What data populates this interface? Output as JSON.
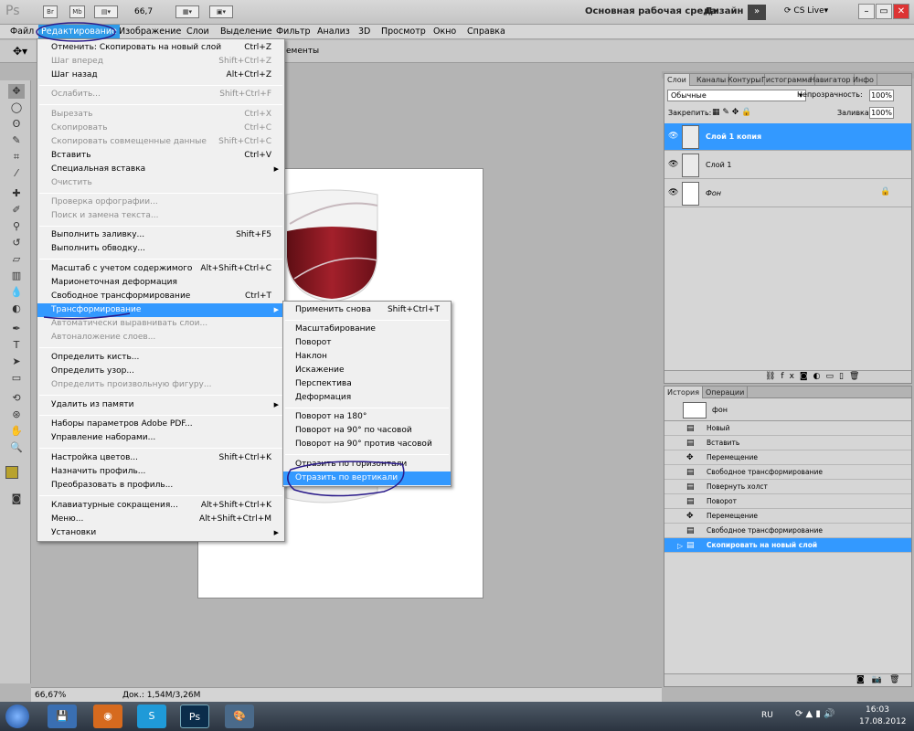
{
  "appbar": {
    "logo": "Ps",
    "br_label": "Br",
    "mb_label": "Mb",
    "zoom": "66,7",
    "workspace": "Основная рабочая среда",
    "design": "Дизайн",
    "cslive": "CS Live"
  },
  "menubar": {
    "items": [
      "Файл",
      "Редактирование",
      "Изображение",
      "Слои",
      "Выделение",
      "Фильтр",
      "Анализ",
      "3D",
      "Просмотр",
      "Окно",
      "Справка"
    ]
  },
  "options": {
    "text": "ементы"
  },
  "edit_menu": {
    "items": [
      {
        "label": "Отменить: Скопировать на новый слой",
        "shortcut": "Ctrl+Z"
      },
      {
        "label": "Шаг вперед",
        "shortcut": "Shift+Ctrl+Z"
      },
      {
        "label": "Шаг назад",
        "shortcut": "Alt+Ctrl+Z"
      },
      {
        "label": "Ослабить...",
        "shortcut": "Shift+Ctrl+F"
      },
      {
        "label": "Вырезать",
        "shortcut": "Ctrl+X"
      },
      {
        "label": "Скопировать",
        "shortcut": "Ctrl+C"
      },
      {
        "label": "Скопировать совмещенные данные",
        "shortcut": "Shift+Ctrl+C"
      },
      {
        "label": "Вставить",
        "shortcut": "Ctrl+V"
      },
      {
        "label": "Специальная вставка",
        "shortcut": ""
      },
      {
        "label": "Очистить",
        "shortcut": ""
      },
      {
        "label": "Проверка орфографии...",
        "shortcut": ""
      },
      {
        "label": "Поиск и замена текста...",
        "shortcut": ""
      },
      {
        "label": "Выполнить заливку...",
        "shortcut": "Shift+F5"
      },
      {
        "label": "Выполнить обводку...",
        "shortcut": ""
      },
      {
        "label": "Масштаб с учетом содержимого",
        "shortcut": "Alt+Shift+Ctrl+C"
      },
      {
        "label": "Марионеточная деформация",
        "shortcut": ""
      },
      {
        "label": "Свободное трансформирование",
        "shortcut": "Ctrl+T"
      },
      {
        "label": "Трансформирование",
        "shortcut": ""
      },
      {
        "label": "Автоматически выравнивать слои...",
        "shortcut": ""
      },
      {
        "label": "Автоналожение слоев...",
        "shortcut": ""
      },
      {
        "label": "Определить кисть...",
        "shortcut": ""
      },
      {
        "label": "Определить узор...",
        "shortcut": ""
      },
      {
        "label": "Определить произвольную фигуру...",
        "shortcut": ""
      },
      {
        "label": "Удалить из памяти",
        "shortcut": ""
      },
      {
        "label": "Наборы параметров Adobe PDF...",
        "shortcut": ""
      },
      {
        "label": "Управление наборами...",
        "shortcut": ""
      },
      {
        "label": "Настройка цветов...",
        "shortcut": "Shift+Ctrl+K"
      },
      {
        "label": "Назначить профиль...",
        "shortcut": ""
      },
      {
        "label": "Преобразовать в профиль...",
        "shortcut": ""
      },
      {
        "label": "Клавиатурные сокращения...",
        "shortcut": "Alt+Shift+Ctrl+K"
      },
      {
        "label": "Меню...",
        "shortcut": "Alt+Shift+Ctrl+M"
      },
      {
        "label": "Установки",
        "shortcut": ""
      }
    ]
  },
  "transform_menu": {
    "items": [
      {
        "label": "Применить снова",
        "shortcut": "Shift+Ctrl+T"
      },
      {
        "label": "Масштабирование",
        "shortcut": ""
      },
      {
        "label": "Поворот",
        "shortcut": ""
      },
      {
        "label": "Наклон",
        "shortcut": ""
      },
      {
        "label": "Искажение",
        "shortcut": ""
      },
      {
        "label": "Перспектива",
        "shortcut": ""
      },
      {
        "label": "Деформация",
        "shortcut": ""
      },
      {
        "label": "Поворот на 180°",
        "shortcut": ""
      },
      {
        "label": "Поворот на 90° по часовой",
        "shortcut": ""
      },
      {
        "label": "Поворот на 90° против часовой",
        "shortcut": ""
      },
      {
        "label": "Отразить по горизонтали",
        "shortcut": ""
      },
      {
        "label": "Отразить по вертикали",
        "shortcut": ""
      }
    ]
  },
  "layers": {
    "tabs": [
      "Слои",
      "Каналы",
      "Контуры",
      "Гистограмма",
      "Навигатор",
      "Инфо"
    ],
    "blend_mode": "Обычные",
    "opacity_label": "Непрозрачность:",
    "opacity": "100%",
    "lock_label": "Закрепить:",
    "fill_label": "Заливка:",
    "fill": "100%",
    "items": [
      {
        "name": "Слой 1 копия"
      },
      {
        "name": "Слой 1"
      },
      {
        "name": "Фон"
      }
    ]
  },
  "history": {
    "tabs": [
      "История",
      "Операции"
    ],
    "snapshot": "фон",
    "items": [
      "Новый",
      "Вставить",
      "Перемещение",
      "Свободное трансформирование",
      "Повернуть холст",
      "Поворот",
      "Перемещение",
      "Свободное трансформирование",
      "Скопировать на новый слой"
    ]
  },
  "status": {
    "zoom": "66,67%",
    "doc": "Док.: 1,54M/3,26M"
  },
  "taskbar": {
    "lang": "RU",
    "time": "16:03",
    "date": "17.08.2012"
  },
  "colors": {
    "highlight": "#3399ff",
    "wine": "#8a1a22",
    "annotation": "#2a1a8a"
  }
}
